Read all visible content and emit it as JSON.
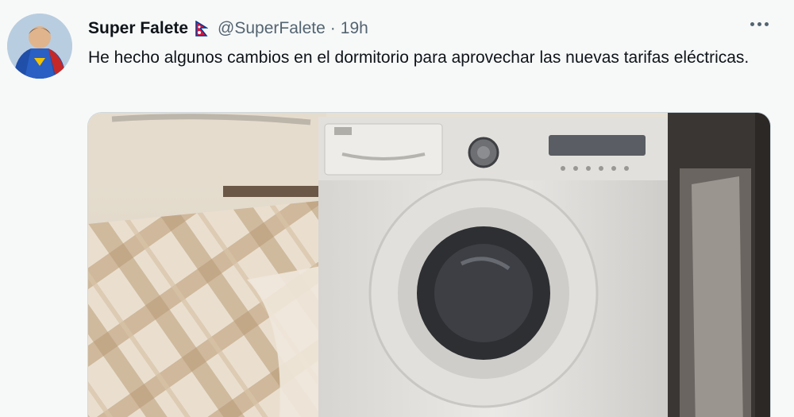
{
  "tweet": {
    "display_name": "Super Falete",
    "handle": "@SuperFalete",
    "separator": "·",
    "time": "19h",
    "text": "He hecho algunos cambios en el dormitorio para aprovechar las nuevas tarifas eléctricas.",
    "icons": {
      "avatar": "superhero-avatar",
      "flag": "nepal-flag-icon",
      "more": "more-options-icon"
    }
  },
  "colors": {
    "background": "#f7f9f9",
    "secondary_text": "#536471",
    "primary_text": "#0f1419"
  }
}
